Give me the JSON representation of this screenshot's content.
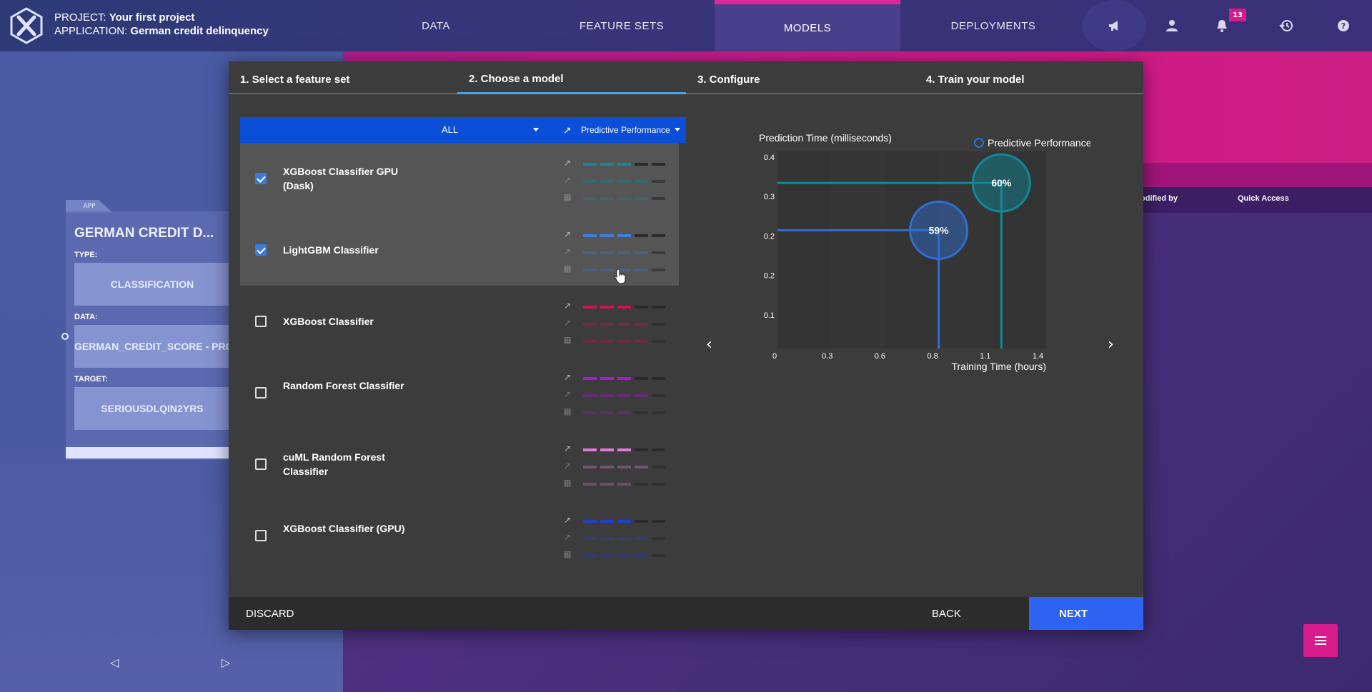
{
  "header": {
    "project_label": "PROJECT:",
    "project_name": "Your first project",
    "application_label": "APPLICATION:",
    "application_name": "German credit delinquency",
    "nav": [
      {
        "label": "DATA"
      },
      {
        "label": "FEATURE SETS"
      },
      {
        "label": "MODELS"
      },
      {
        "label": "DEPLOYMENTS"
      }
    ],
    "notification_count": "13"
  },
  "background": {
    "col_modified_by": "odified by",
    "col_quick_access": "Quick Access"
  },
  "app_card": {
    "tag": "APP",
    "title": "GERMAN CREDIT D...",
    "type_label": "TYPE:",
    "type_value": "CLASSIFICATION",
    "data_label": "DATA:",
    "data_value": "GERMAN_CREDIT_SCORE - PRO",
    "target_label": "TARGET:",
    "target_value": "SERIOUSDLQIN2YRS"
  },
  "dialog": {
    "steps": [
      {
        "label": "1. Select a feature set"
      },
      {
        "label": "2. Choose a model"
      },
      {
        "label": "3. Configure"
      },
      {
        "label": "4. Train your model"
      }
    ],
    "filter": {
      "category": "ALL",
      "sort": "Predictive Performance"
    },
    "models": [
      {
        "name": "XGBoost Classifier GPU (Dask)",
        "checked": true,
        "color": "#0e8a9a",
        "scores": [
          3,
          4,
          4
        ]
      },
      {
        "name": "LightGBM Classifier",
        "checked": true,
        "color": "#3e7fdc",
        "scores": [
          3,
          4,
          4
        ]
      },
      {
        "name": "XGBoost Classifier",
        "checked": false,
        "color": "#d4124e",
        "scores": [
          3,
          4,
          4
        ]
      },
      {
        "name": "Random Forest Classifier",
        "checked": false,
        "color": "#b014d8",
        "scores": [
          3,
          4,
          3
        ]
      },
      {
        "name": "cuML Random Forest Classifier",
        "checked": false,
        "color": "#e27ad8",
        "scores": [
          3,
          4,
          3
        ]
      },
      {
        "name": "XGBoost Classifier (GPU)",
        "checked": false,
        "color": "#1f3fd0",
        "scores": [
          3,
          4,
          4
        ]
      }
    ],
    "chart": {
      "legend": "Predictive Performance"
    },
    "footer": {
      "discard": "DISCARD",
      "back": "BACK",
      "next": "NEXT"
    }
  },
  "chart_data": {
    "type": "scatter",
    "ylabel": "Prediction Time (milliseconds)",
    "xlabel": "Training Time (hours)",
    "x_ticks": [
      "0",
      "0.3",
      "0.6",
      "0.8",
      "1.1",
      "1.4"
    ],
    "y_ticks": [
      "0.4",
      "0.3",
      "0.2",
      "0.2",
      "0.1"
    ],
    "xlim": [
      0,
      1.5
    ],
    "ylim": [
      0,
      0.5
    ],
    "legend": [
      "Predictive Performance"
    ],
    "series": [
      {
        "x": 0.9,
        "y": 0.3,
        "label": "59%",
        "color": "#2e6fd6"
      },
      {
        "x": 1.25,
        "y": 0.42,
        "label": "60%",
        "color": "#0e8a9a"
      }
    ]
  }
}
